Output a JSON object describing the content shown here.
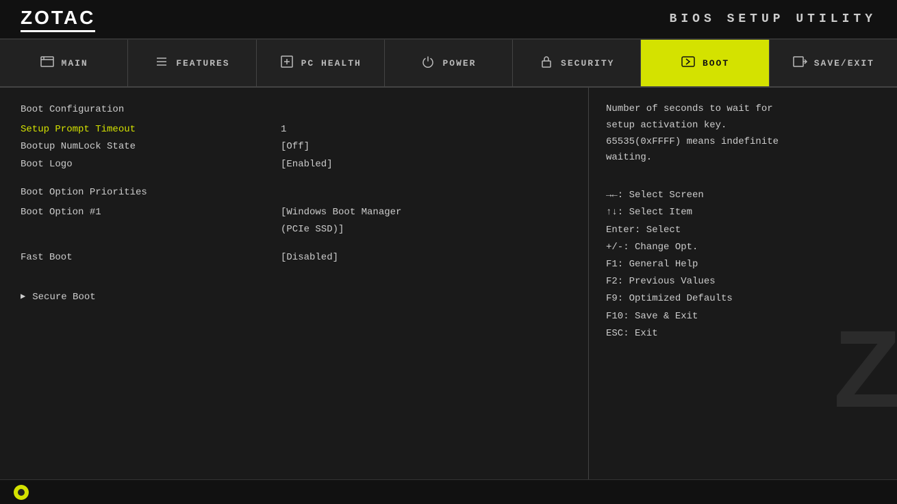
{
  "header": {
    "logo": "ZOTAC",
    "bios_title": "BIOS SETUP UTILITY"
  },
  "nav": {
    "tabs": [
      {
        "id": "main",
        "label": "MAIN",
        "icon": "💽",
        "active": false
      },
      {
        "id": "features",
        "label": "FEATURES",
        "icon": "≡",
        "active": false
      },
      {
        "id": "pc-health",
        "label": "PC HEALTH",
        "icon": "➕",
        "active": false
      },
      {
        "id": "power",
        "label": "POWER",
        "icon": "⏻",
        "active": false
      },
      {
        "id": "security",
        "label": "SECURITY",
        "icon": "🔒",
        "active": false
      },
      {
        "id": "boot",
        "label": "BOOT",
        "icon": "↩",
        "active": true
      },
      {
        "id": "save-exit",
        "label": "SAVE/EXIT",
        "icon": "→",
        "active": false
      }
    ]
  },
  "main": {
    "menu_items": [
      {
        "label": "Boot Configuration",
        "value": "",
        "selected": false,
        "type": "header"
      },
      {
        "label": "Setup Prompt Timeout",
        "value": "1",
        "selected": true,
        "type": "item"
      },
      {
        "label": "Bootup NumLock State",
        "value": "[Off]",
        "selected": false,
        "type": "item"
      },
      {
        "label": "Boot Logo",
        "value": "[Enabled]",
        "selected": false,
        "type": "item"
      }
    ],
    "menu_items2": [
      {
        "label": "Boot Option Priorities",
        "value": "",
        "selected": false,
        "type": "header"
      },
      {
        "label": "Boot Option #1",
        "value": "[Windows Boot Manager\n(PCIe SSD)]",
        "selected": false,
        "type": "item"
      }
    ],
    "menu_items3": [
      {
        "label": "Fast Boot",
        "value": "[Disabled]",
        "selected": false,
        "type": "item"
      }
    ],
    "submenu_items": [
      {
        "label": "Secure Boot",
        "has_arrow": true
      }
    ]
  },
  "right_panel": {
    "help_text": "Number of seconds to wait for setup activation key.\n65535(0xFFFF) means indefinite waiting.",
    "key_help": [
      "→←: Select Screen",
      "↑↓: Select Item",
      "Enter: Select",
      "+/-: Change Opt.",
      "F1: General Help",
      "F2: Previous Values",
      "F9: Optimized Defaults",
      "F10: Save & Exit",
      "ESC: Exit"
    ]
  },
  "footer": {
    "dot_color": "#d4e200"
  }
}
